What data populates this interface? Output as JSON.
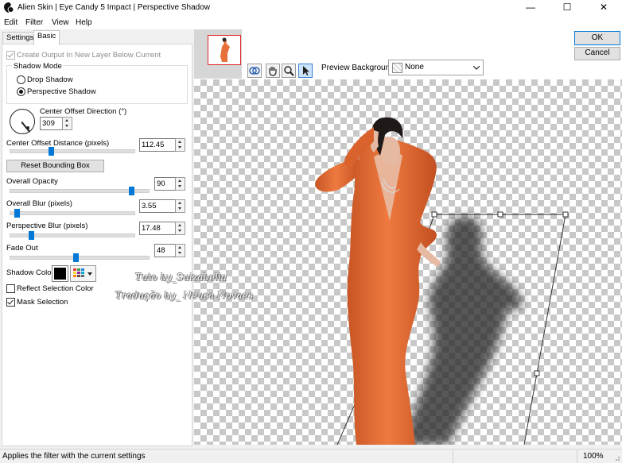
{
  "window": {
    "title": "Alien Skin | Eye Candy 5 Impact | Perspective Shadow",
    "minimize": "—",
    "maximize": "☐",
    "close": "✕"
  },
  "menu": [
    "Edit",
    "Filter",
    "View",
    "Help"
  ],
  "tabs": [
    {
      "label": "Settings",
      "active": false
    },
    {
      "label": "Basic",
      "active": true
    }
  ],
  "basic": {
    "create_output_label": "Create Output In New Layer Below Current",
    "create_output_checked": true,
    "shadow_mode_label": "Shadow Mode",
    "shadow_mode_options": [
      {
        "label": "Drop Shadow",
        "selected": false
      },
      {
        "label": "Perspective Shadow",
        "selected": true
      }
    ],
    "center_offset_direction_label": "Center Offset Direction (°)",
    "center_offset_direction_value": "309",
    "center_offset_distance_label": "Center Offset Distance (pixels)",
    "center_offset_distance_value": "112.45",
    "center_offset_distance_fraction": 0.33,
    "reset_bounding_box_label": "Reset Bounding Box",
    "overall_opacity_label": "Overall Opacity",
    "overall_opacity_value": "90",
    "overall_opacity_fraction": 0.9,
    "overall_blur_label": "Overall Blur (pixels)",
    "overall_blur_value": "3.55",
    "overall_blur_fraction": 0.04,
    "perspective_blur_label": "Perspective Blur (pixels)",
    "perspective_blur_value": "17.48",
    "perspective_blur_fraction": 0.16,
    "fade_out_label": "Fade Out",
    "fade_out_value": "48",
    "fade_out_fraction": 0.48,
    "shadow_color_label": "Shadow Color",
    "shadow_color": "#000000",
    "reflect_selection_color_label": "Reflect Selection Color",
    "reflect_selection_color_checked": false,
    "mask_selection_label": "Mask Selection",
    "mask_selection_checked": true
  },
  "preview": {
    "background_label": "Preview Background:",
    "background_value": "None",
    "tools": [
      "eye-toggle-icon",
      "hand-icon",
      "zoom-icon",
      "pointer-icon"
    ],
    "selected_tool": "pointer-icon"
  },
  "actions": {
    "ok": "OK",
    "cancel": "Cancel"
  },
  "status": {
    "message": "Applies the filter with the current settings",
    "zoom": "100%"
  },
  "watermark": {
    "line1": "Tuto by_Suizabella",
    "line2": "Tradução by_ Neusa Novaes"
  },
  "colors": {
    "accent": "#0078d7",
    "dress": "#e8703a",
    "bounding_box": "#222222"
  }
}
